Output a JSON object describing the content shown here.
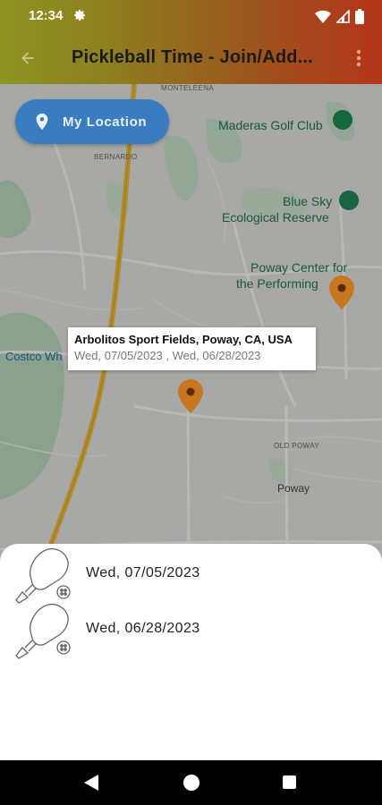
{
  "status": {
    "time": "12:34",
    "icons": [
      "gear-icon",
      "wifi-icon",
      "signal-icon",
      "battery-icon"
    ]
  },
  "appbar": {
    "title": "Pickleball Time - Join/Add...",
    "back_icon": "arrow-left-icon",
    "menu_icon": "more-vert-icon"
  },
  "my_location": {
    "label": "My Location",
    "icon": "location-pin-icon",
    "color": "#3a7cc0"
  },
  "map": {
    "labels": {
      "monteleena": "MONTELEENA",
      "bernardo": "BERNARDO",
      "maderas": "Maderas Golf Club",
      "blue_sky_1": "Blue Sky",
      "blue_sky_2": "Ecological Reserve",
      "poway_center_1": "Poway Center for",
      "poway_center_2": "the Performing",
      "costco": "Costco Wh",
      "old_poway": "OLD POWAY",
      "poway": "Poway"
    }
  },
  "info_window": {
    "title": "Arbolitos Sport Fields, Poway, CA, USA",
    "snippet": "Wed, 07/05/2023 , Wed, 06/28/2023"
  },
  "marker_color": "#c8761f",
  "sheet": {
    "dates": [
      {
        "label": "Wed, 07/05/2023",
        "icon": "pickleball-paddle-icon"
      },
      {
        "label": "Wed, 06/28/2023",
        "icon": "pickleball-paddle-icon"
      }
    ]
  },
  "navbar": {
    "icons": [
      "back-triangle-icon",
      "home-circle-icon",
      "recents-square-icon"
    ]
  }
}
